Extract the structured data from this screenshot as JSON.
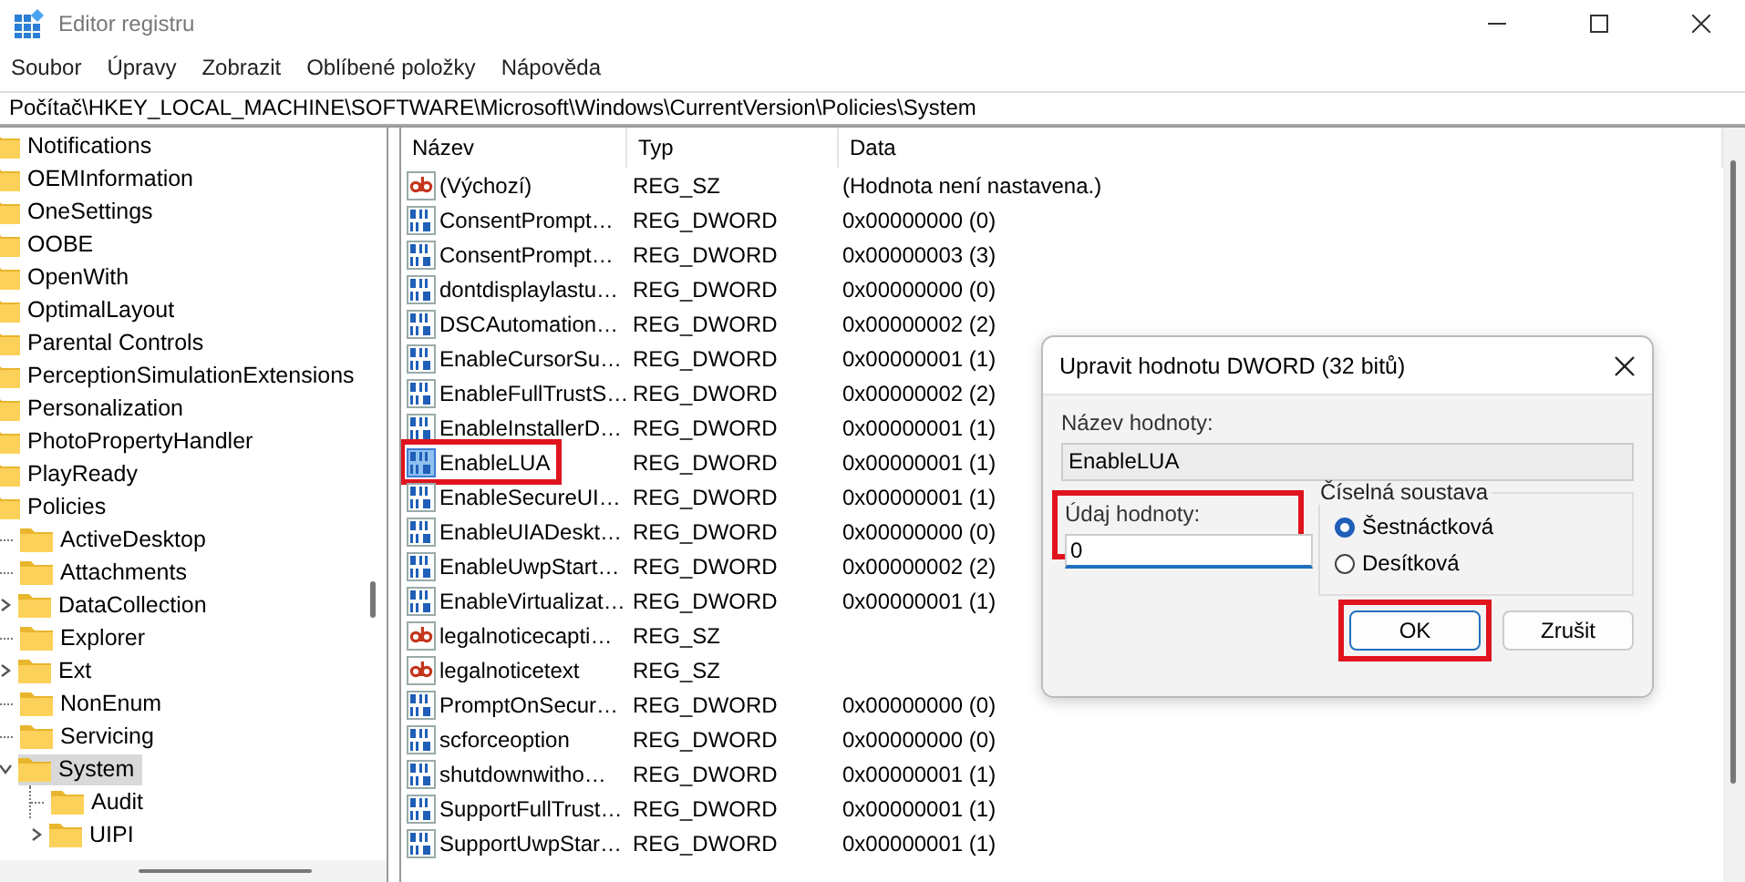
{
  "window": {
    "title": "Editor registru"
  },
  "menu": [
    "Soubor",
    "Úpravy",
    "Zobrazit",
    "Oblíbené položky",
    "Nápověda"
  ],
  "address": "Počítač\\HKEY_LOCAL_MACHINE\\SOFTWARE\\Microsoft\\Windows\\CurrentVersion\\Policies\\System",
  "tree": [
    {
      "label": "Notifications",
      "selected": false
    },
    {
      "label": "OEMInformation",
      "selected": false
    },
    {
      "label": "OneSettings",
      "selected": false
    },
    {
      "label": "OOBE",
      "selected": false
    },
    {
      "label": "OpenWith",
      "selected": false
    },
    {
      "label": "OptimalLayout",
      "selected": false
    },
    {
      "label": "Parental Controls",
      "selected": false
    },
    {
      "label": "PerceptionSimulationExtensions",
      "selected": false
    },
    {
      "label": "Personalization",
      "selected": false
    },
    {
      "label": "PhotoPropertyHandler",
      "selected": false
    },
    {
      "label": "PlayReady",
      "selected": false
    },
    {
      "label": "Policies",
      "selected": false,
      "children": [
        {
          "label": "ActiveDesktop",
          "selected": false,
          "expandable": false
        },
        {
          "label": "Attachments",
          "selected": false,
          "expandable": false
        },
        {
          "label": "DataCollection",
          "selected": false,
          "expandable": true,
          "expanded": false
        },
        {
          "label": "Explorer",
          "selected": false,
          "expandable": false
        },
        {
          "label": "Ext",
          "selected": false,
          "expandable": true,
          "expanded": false
        },
        {
          "label": "NonEnum",
          "selected": false,
          "expandable": false
        },
        {
          "label": "Servicing",
          "selected": false,
          "expandable": false
        },
        {
          "label": "System",
          "selected": true,
          "expandable": true,
          "expanded": true,
          "children": [
            {
              "label": "Audit",
              "selected": false,
              "expandable": false
            },
            {
              "label": "UIPI",
              "selected": false,
              "expandable": true,
              "expanded": false
            }
          ]
        }
      ]
    }
  ],
  "list": {
    "columns": [
      "Název",
      "Typ",
      "Data"
    ],
    "rows": [
      {
        "kind": "string",
        "name": "(Výchozí)",
        "type": "REG_SZ",
        "data": "(Hodnota není nastavena.)",
        "selected": false,
        "highlighted": false
      },
      {
        "kind": "binary",
        "name": "ConsentPrompt…",
        "type": "REG_DWORD",
        "data": "0x00000000 (0)",
        "selected": false,
        "highlighted": false
      },
      {
        "kind": "binary",
        "name": "ConsentPrompt…",
        "type": "REG_DWORD",
        "data": "0x00000003 (3)",
        "selected": false,
        "highlighted": false
      },
      {
        "kind": "binary",
        "name": "dontdisplaylastu…",
        "type": "REG_DWORD",
        "data": "0x00000000 (0)",
        "selected": false,
        "highlighted": false
      },
      {
        "kind": "binary",
        "name": "DSCAutomation…",
        "type": "REG_DWORD",
        "data": "0x00000002 (2)",
        "selected": false,
        "highlighted": false
      },
      {
        "kind": "binary",
        "name": "EnableCursorSu…",
        "type": "REG_DWORD",
        "data": "0x00000001 (1)",
        "selected": false,
        "highlighted": false
      },
      {
        "kind": "binary",
        "name": "EnableFullTrustS…",
        "type": "REG_DWORD",
        "data": "0x00000002 (2)",
        "selected": false,
        "highlighted": false
      },
      {
        "kind": "binary",
        "name": "EnableInstallerD…",
        "type": "REG_DWORD",
        "data": "0x00000001 (1)",
        "selected": false,
        "highlighted": false
      },
      {
        "kind": "binary",
        "name": "EnableLUA",
        "type": "REG_DWORD",
        "data": "0x00000001 (1)",
        "selected": true,
        "highlighted": true
      },
      {
        "kind": "binary",
        "name": "EnableSecureUI…",
        "type": "REG_DWORD",
        "data": "0x00000001 (1)",
        "selected": false,
        "highlighted": false
      },
      {
        "kind": "binary",
        "name": "EnableUIADeskt…",
        "type": "REG_DWORD",
        "data": "0x00000000 (0)",
        "selected": false,
        "highlighted": false
      },
      {
        "kind": "binary",
        "name": "EnableUwpStart…",
        "type": "REG_DWORD",
        "data": "0x00000002 (2)",
        "selected": false,
        "highlighted": false
      },
      {
        "kind": "binary",
        "name": "EnableVirtualizat…",
        "type": "REG_DWORD",
        "data": "0x00000001 (1)",
        "selected": false,
        "highlighted": false
      },
      {
        "kind": "string",
        "name": "legalnoticecapti…",
        "type": "REG_SZ",
        "selected": false,
        "highlighted": false
      },
      {
        "kind": "string",
        "name": "legalnoticetext",
        "type": "REG_SZ",
        "selected": false,
        "highlighted": false
      },
      {
        "kind": "binary",
        "name": "PromptOnSecur…",
        "type": "REG_DWORD",
        "data": "0x00000000 (0)",
        "selected": false,
        "highlighted": false
      },
      {
        "kind": "binary",
        "name": "scforceoption",
        "type": "REG_DWORD",
        "data": "0x00000000 (0)",
        "selected": false,
        "highlighted": false
      },
      {
        "kind": "binary",
        "name": "shutdownwitho…",
        "type": "REG_DWORD",
        "data": "0x00000001 (1)",
        "selected": false,
        "highlighted": false
      },
      {
        "kind": "binary",
        "name": "SupportFullTrust…",
        "type": "REG_DWORD",
        "data": "0x00000001 (1)",
        "selected": false,
        "highlighted": false
      },
      {
        "kind": "binary",
        "name": "SupportUwpStar…",
        "type": "REG_DWORD",
        "data": "0x00000001 (1)",
        "selected": false,
        "highlighted": false
      }
    ]
  },
  "dialog": {
    "title": "Upravit hodnotu DWORD (32 bitů)",
    "name_label": "Název hodnoty:",
    "name_value": "EnableLUA",
    "value_label": "Údaj hodnoty:",
    "value": "0",
    "value_highlighted": true,
    "base_group": "Číselná soustava",
    "bases": [
      {
        "label": "Šestnáctková",
        "selected": true
      },
      {
        "label": "Desítková",
        "selected": false
      }
    ],
    "buttons": [
      {
        "label": "OK",
        "default": true,
        "highlighted": true
      },
      {
        "label": "Zrušit",
        "default": false,
        "highlighted": false
      }
    ]
  }
}
